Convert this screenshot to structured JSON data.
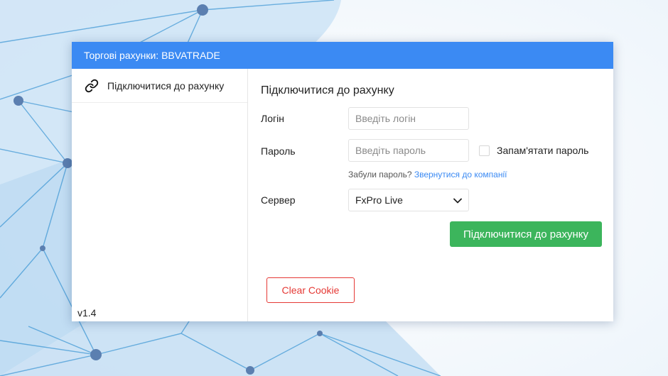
{
  "window": {
    "title": "Торгові рахунки: BBVATRADE"
  },
  "sidebar": {
    "items": [
      {
        "label": "Підключитися до рахунку",
        "icon": "link-icon"
      }
    ],
    "version": "v1.4"
  },
  "form": {
    "title": "Підключитися до рахунку",
    "login": {
      "label": "Логін",
      "placeholder": "Введіть логін",
      "value": ""
    },
    "password": {
      "label": "Пароль",
      "placeholder": "Введіть пароль",
      "value": ""
    },
    "remember": {
      "label": "Запам'ятати пароль",
      "checked": false
    },
    "forgot": {
      "text": "Забули пароль?",
      "link": "Звернутися до компанії"
    },
    "server": {
      "label": "Сервер",
      "selected": "FxPro Live",
      "icon": "chevron-down-icon"
    },
    "connect_button": "Підключитися до рахунку",
    "clear_cookie_button": "Clear Cookie"
  },
  "colors": {
    "titlebar": "#3b8af3",
    "connect": "#3cb55c",
    "danger": "#e53935",
    "link": "#3b8af3"
  }
}
